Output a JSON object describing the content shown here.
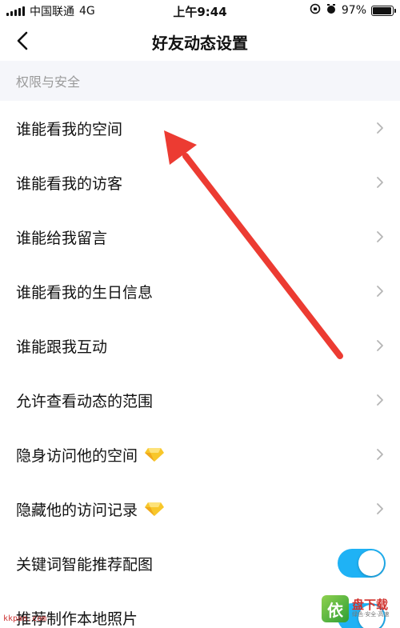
{
  "status_bar": {
    "carrier": "中国联通",
    "network": "4G",
    "time": "上午9:44",
    "battery": "97%",
    "battery_level": 0.97
  },
  "nav": {
    "title": "好友动态设置"
  },
  "section": {
    "title": "权限与安全"
  },
  "rows": [
    {
      "label": "谁能看我的空间"
    },
    {
      "label": "谁能看我的访客"
    },
    {
      "label": "谁能给我留言"
    },
    {
      "label": "谁能看我的生日信息"
    },
    {
      "label": "谁能跟我互动"
    },
    {
      "label": "允许查看动态的范围"
    },
    {
      "label": "隐身访问他的空间"
    },
    {
      "label": "隐藏他的访问记录"
    },
    {
      "label": "关键词智能推荐配图",
      "toggle_on": true
    },
    {
      "label": "推荐制作本地照片",
      "toggle_on": true
    }
  ],
  "colors": {
    "toggle_on": "#1fb2f5",
    "arrow": "#ec3b32",
    "section_bg": "#f5f6fa"
  },
  "watermark": {
    "mark": "依",
    "main": "盘下载",
    "sub": "绿色·安全·高速",
    "site": "kkpan.com"
  }
}
